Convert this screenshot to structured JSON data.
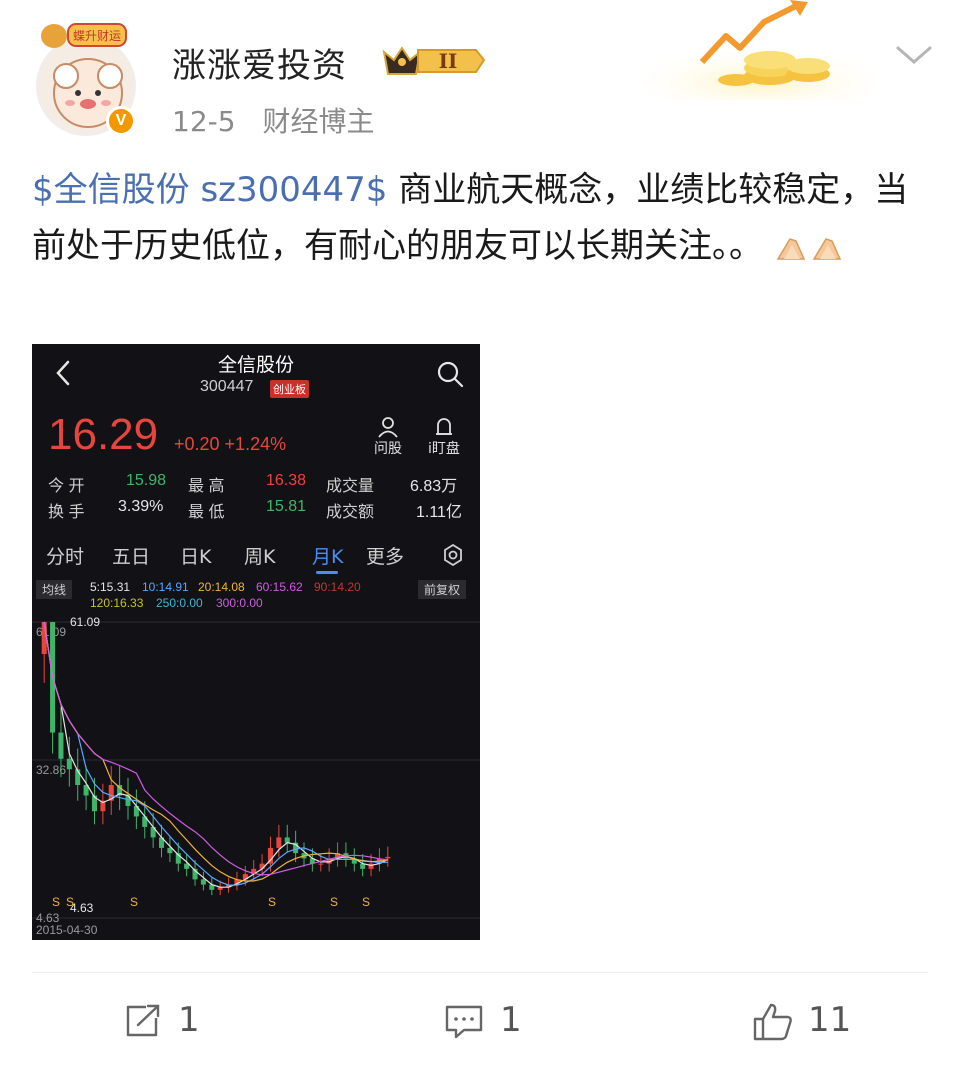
{
  "header": {
    "username": "涨涨爱投资",
    "avatar_badge_text": "蝶升财运",
    "level_badge": "II",
    "date": "12-5",
    "role": "财经博主"
  },
  "post": {
    "stock_tag": "$全信股份 sz300447$",
    "text": " 商业航天概念，业绩比较稳定，当前处于历史低位，有耐心的朋友可以长期关注。。"
  },
  "stock": {
    "name": "全信股份",
    "code": "300447",
    "board": "创业板",
    "price": "16.29",
    "change": "+0.20 +1.24%",
    "ask_label": "问股",
    "watch_label": "i盯盘",
    "quote_row1": {
      "open_label": "今 开",
      "open": "15.98",
      "high_label": "最 高",
      "high": "16.38",
      "vol_label": "成交量",
      "vol": "6.83万"
    },
    "quote_row2": {
      "turnover_label": "换 手",
      "turnover": "3.39%",
      "low_label": "最 低",
      "low": "15.81",
      "amount_label": "成交额",
      "amount": "1.11亿"
    },
    "tabs": [
      "分时",
      "五日",
      "日K",
      "周K",
      "月K",
      "更多"
    ],
    "active_tab": "月K",
    "ma_chip": "均线",
    "adjust_chip": "前复权",
    "ma_legend": [
      {
        "text": "5:15.31",
        "color": "#e6e6e6"
      },
      {
        "text": "10:14.91",
        "color": "#5aa7ff"
      },
      {
        "text": "20:14.08",
        "color": "#f0b33c"
      },
      {
        "text": "60:15.62",
        "color": "#d05ce3"
      },
      {
        "text": "90:14.20",
        "color": "#c0392b"
      },
      {
        "text": "120:16.33",
        "color": "#c8c02a"
      },
      {
        "text": "250:0.00",
        "color": "#3fb5d9"
      },
      {
        "text": "300:0.00",
        "color": "#d05ce3"
      }
    ]
  },
  "chart_data": {
    "type": "candlestick",
    "y_ticks": [
      "61.09",
      "32.86",
      "4.63"
    ],
    "max_label": "61.09",
    "min_label": "4.63",
    "x_start_label": "2015-04-30",
    "ylim": [
      4.63,
      61.09
    ],
    "closes": [
      61.09,
      40,
      35,
      33,
      30,
      28,
      25,
      27,
      30,
      28,
      26,
      24,
      22,
      20,
      18,
      17,
      15,
      14,
      12,
      11,
      10,
      10.5,
      11,
      12,
      13,
      14,
      15,
      18,
      20,
      19,
      17,
      16,
      15,
      15,
      16,
      17,
      16,
      15,
      14,
      15,
      16,
      16.29
    ],
    "markers": "S"
  },
  "actions": {
    "share_count": "1",
    "comment_count": "1",
    "like_count": "11"
  }
}
